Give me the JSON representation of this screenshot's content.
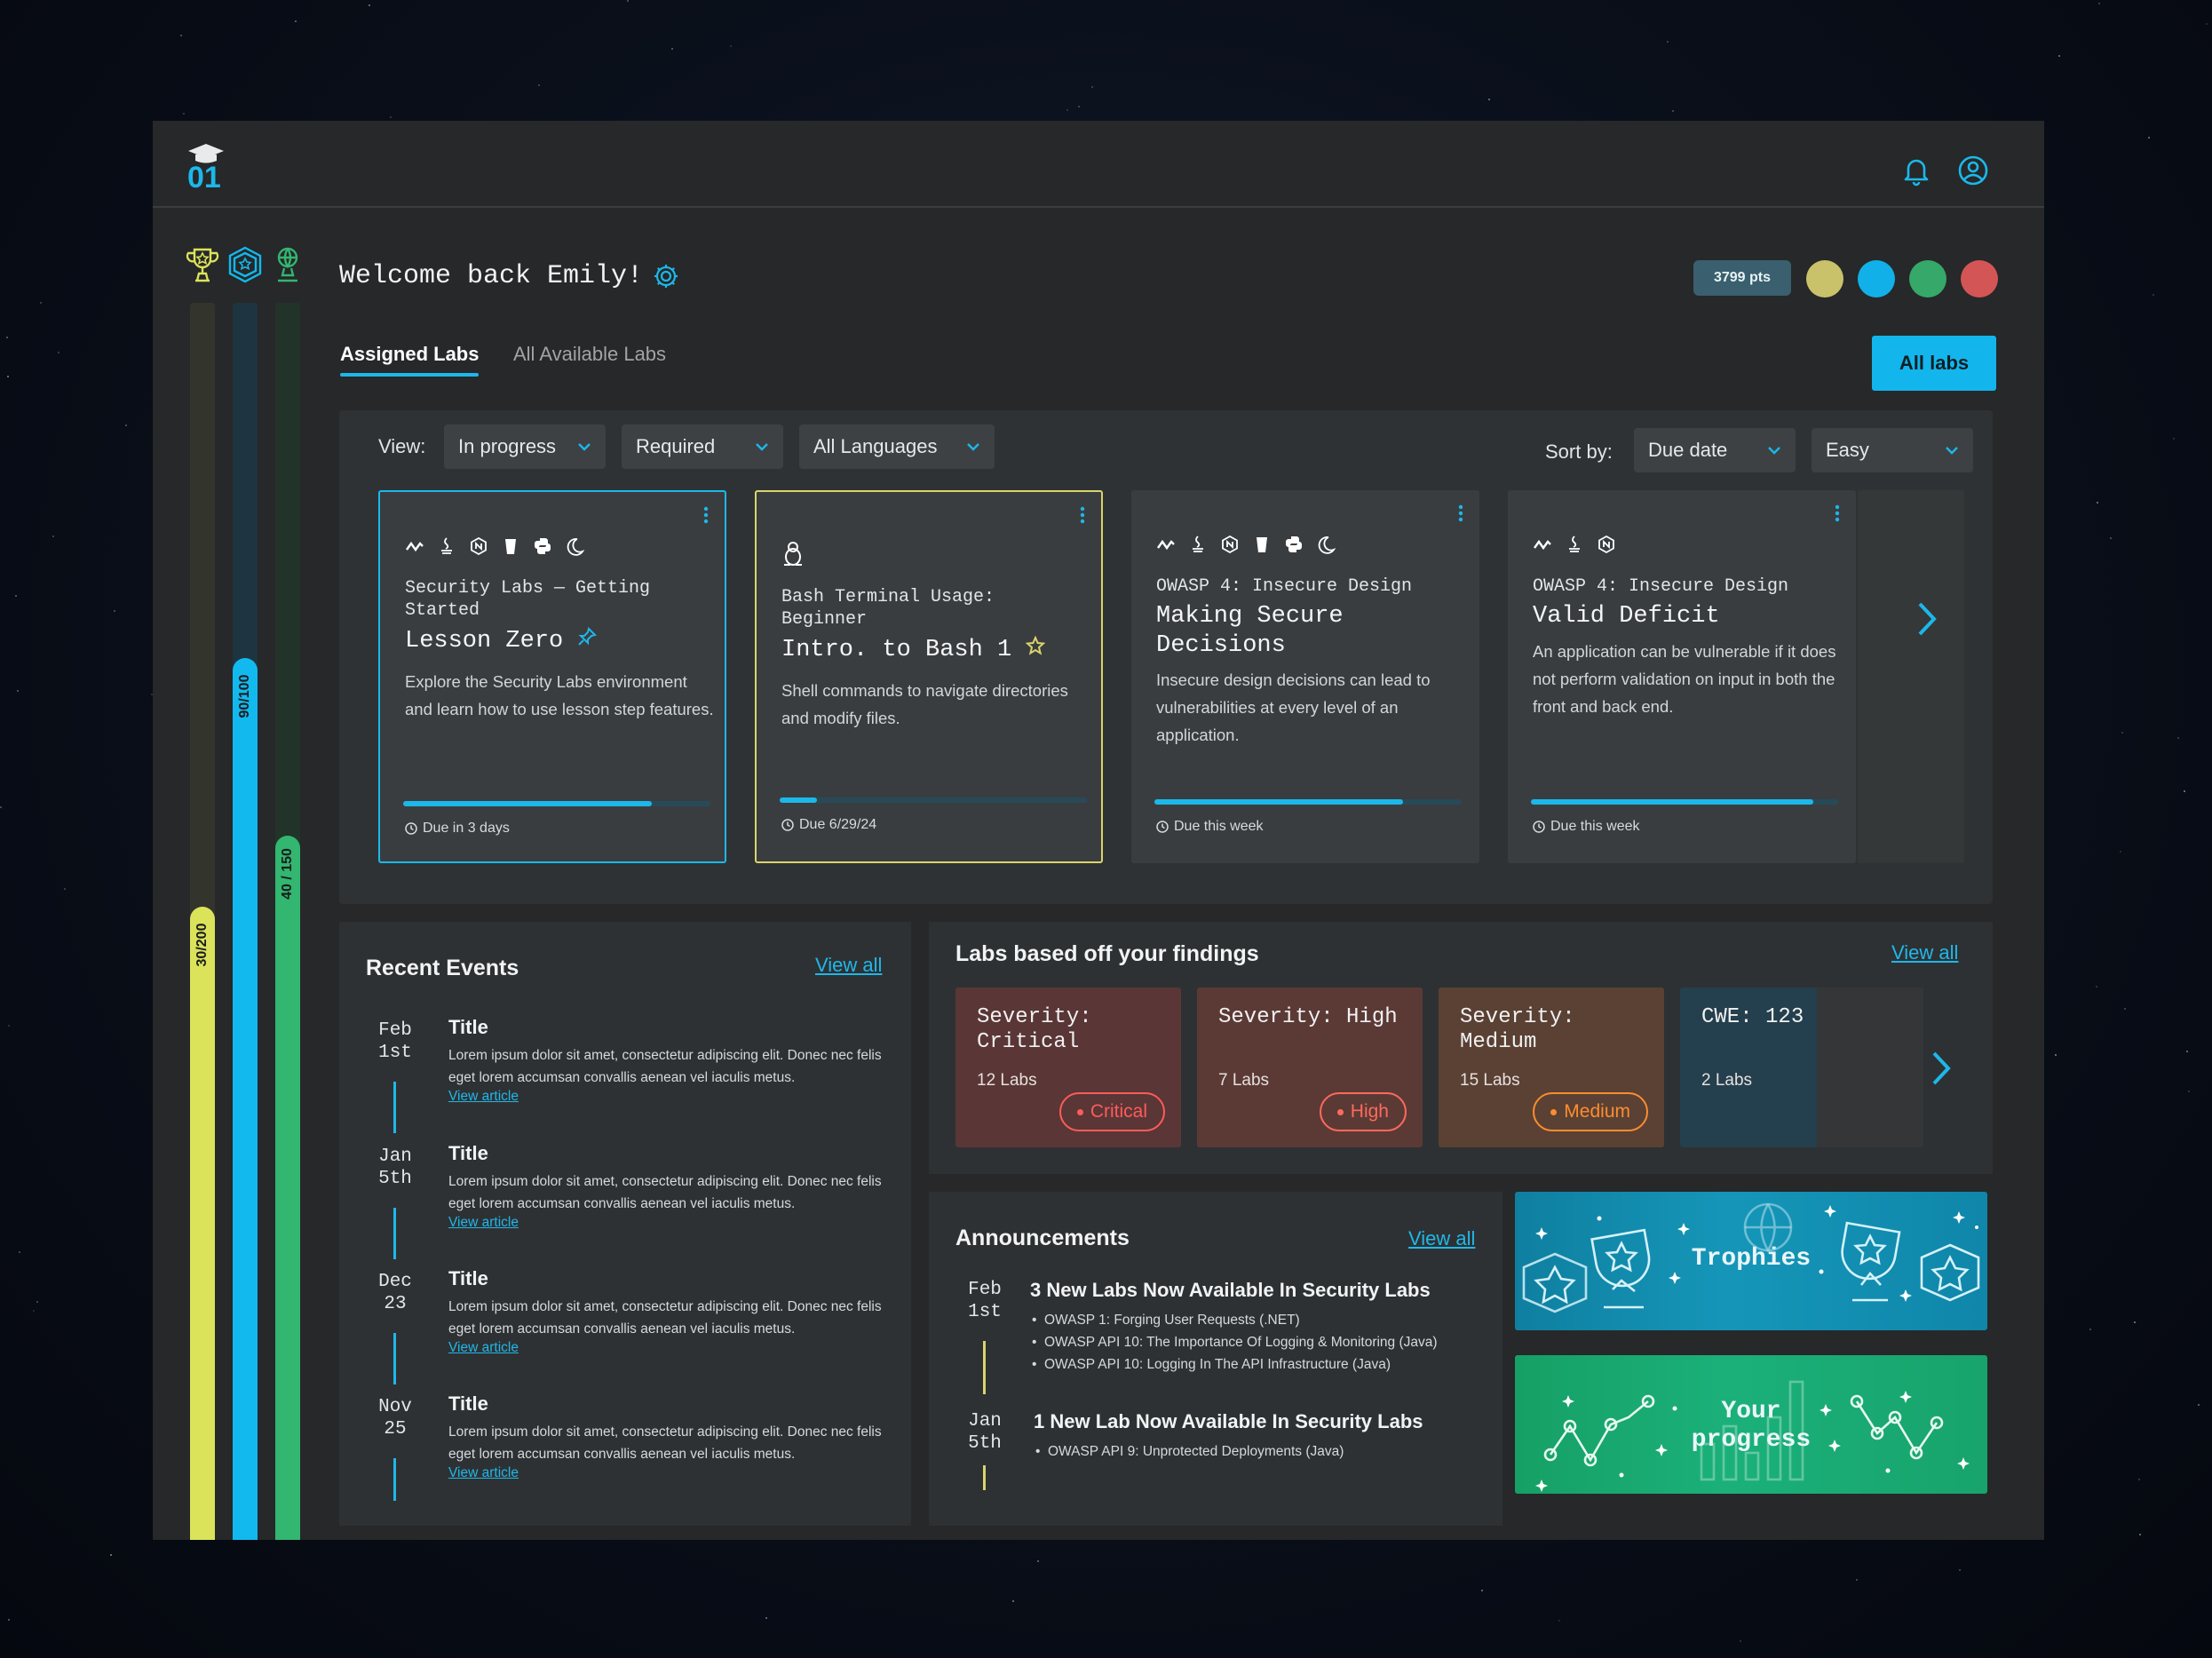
{
  "header": {
    "logo": "01"
  },
  "icons": {
    "bell": "bell-icon",
    "user": "user-circle-icon",
    "gear": "gear-icon",
    "trophy": "trophy-icon",
    "badge": "badge-icon",
    "globe": "globe-trophy-icon"
  },
  "progress_bars": [
    {
      "label": "30/200",
      "value": 30,
      "max": 200,
      "color": "#dbe35b"
    },
    {
      "label": "90/100",
      "value": 90,
      "max": 100,
      "color": "#12b9ee"
    },
    {
      "label": "40 / 150",
      "value": 40,
      "max": 150,
      "color": "#32b670"
    }
  ],
  "welcome": {
    "text": "Welcome back Emily!"
  },
  "points": {
    "label": "3799 pts"
  },
  "color_dots": [
    "#c9c26a",
    "#12b0e8",
    "#35a86a",
    "#d35555"
  ],
  "tabs": {
    "assigned": "Assigned Labs",
    "available": "All Available Labs"
  },
  "all_labs_button": "All labs",
  "filters": {
    "view_label": "View:",
    "view": "In progress",
    "required": "Required",
    "languages": "All Languages",
    "sort_label": "Sort by:",
    "sort": "Due date",
    "difficulty": "Easy"
  },
  "lab_cards": [
    {
      "subtitle": "Security Labs — Getting Started",
      "title": "Lesson Zero",
      "description": "Explore the Security Labs environment and learn how to use lesson step features.",
      "progress": 0.81,
      "due": "Due in 3 days",
      "border": "#1cb8ea"
    },
    {
      "subtitle": "Bash Terminal Usage: Beginner",
      "title": "Intro. to Bash 1",
      "description": "Shell commands to navigate directories and modify files.",
      "progress": 0.12,
      "due": "Due 6/29/24",
      "border": "#d9d46c"
    },
    {
      "subtitle": "OWASP 4: Insecure Design",
      "title": "Making Secure Decisions",
      "description": "Insecure design decisions can lead to vulnerabilities at every level of an application.",
      "progress": 0.81,
      "due": "Due this week",
      "border": ""
    },
    {
      "subtitle": "OWASP 4: Insecure Design",
      "title": "Valid Deficit",
      "description": "An application can be vulnerable if it does not perform validation on input in both the front and back end.",
      "progress": 0.92,
      "due": "Due this week",
      "border": ""
    }
  ],
  "recent_events": {
    "title": "Recent Events",
    "view_all": "View all",
    "items": [
      {
        "date": "Feb 1st",
        "title": "Title",
        "body": "Lorem ipsum dolor sit amet, consectetur adipiscing elit. Donec nec felis eget lorem accumsan convallis aenean vel iaculis metus.",
        "link": "View article"
      },
      {
        "date": "Jan 5th",
        "title": "Title",
        "body": "Lorem ipsum dolor sit amet, consectetur adipiscing elit. Donec nec felis eget lorem accumsan convallis aenean vel iaculis metus.",
        "link": "View article"
      },
      {
        "date": "Dec 23",
        "title": "Title",
        "body": "Lorem ipsum dolor sit amet, consectetur adipiscing elit. Donec nec felis eget lorem accumsan convallis aenean vel iaculis metus.",
        "link": "View article"
      },
      {
        "date": "Nov 25",
        "title": "Title",
        "body": "Lorem ipsum dolor sit amet, consectetur adipiscing elit. Donec nec felis eget lorem accumsan convallis aenean vel iaculis metus.",
        "link": "View article"
      }
    ]
  },
  "findings": {
    "title": "Labs based off your findings",
    "view_all": "View all",
    "cards": [
      {
        "title": "Severity: Critical",
        "count": "12 Labs",
        "pill": "Critical",
        "bg": "#5a3636",
        "pill_color": "#ff5b5b"
      },
      {
        "title": "Severity: High",
        "count": "7 Labs",
        "pill": "High",
        "bg": "#5b3a36",
        "pill_color": "#ff6a5b"
      },
      {
        "title": "Severity: Medium",
        "count": "15 Labs",
        "pill": "Medium",
        "bg": "#5a4134",
        "pill_color": "#ff8c2e"
      },
      {
        "title": "CWE: 123",
        "count": "2 Labs",
        "pill": "",
        "bg": "#243f4d",
        "pill_color": ""
      }
    ]
  },
  "announcements": {
    "title": "Announcements",
    "view_all": "View all",
    "items": [
      {
        "date": "Feb 1st",
        "title": "3 New Labs Now Available In Security Labs",
        "bullets": [
          "OWASP 1: Forging User Requests (.NET)",
          "OWASP API 10: The Importance Of Logging & Monitoring (Java)",
          "OWASP API 10: Logging In The API Infrastructure (Java)"
        ]
      },
      {
        "date": "Jan 5th",
        "title": "1 New Lab Now Available In Security Labs",
        "bullets": [
          "OWASP API 9: Unprotected Deployments (Java)"
        ]
      }
    ]
  },
  "promos": {
    "trophies": "Trophies",
    "progress_line1": "Your",
    "progress_line2": "progress"
  }
}
